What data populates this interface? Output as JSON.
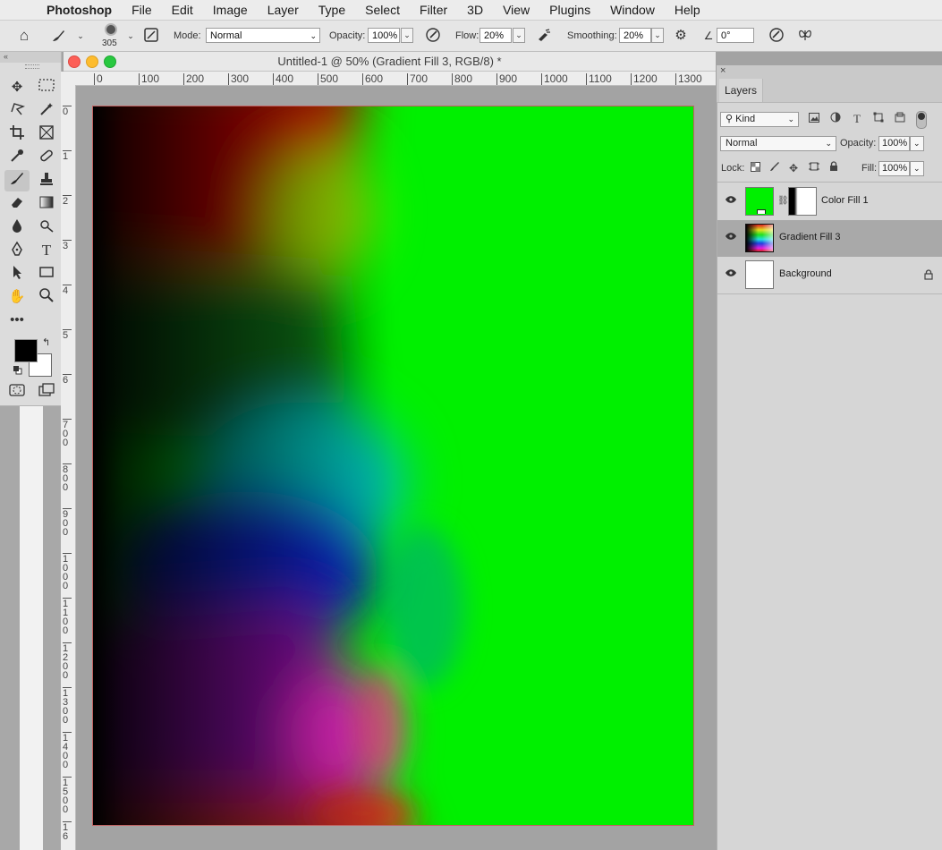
{
  "menubar": {
    "apple_glyph": "",
    "app_name": "Photoshop",
    "items": [
      "File",
      "Edit",
      "Image",
      "Layer",
      "Type",
      "Select",
      "Filter",
      "3D",
      "View",
      "Plugins",
      "Window",
      "Help"
    ]
  },
  "options": {
    "brush_size": "305",
    "mode_label": "Mode:",
    "mode_value": "Normal",
    "opacity_label": "Opacity:",
    "opacity_value": "100%",
    "flow_label": "Flow:",
    "flow_value": "20%",
    "smoothing_label": "Smoothing:",
    "smoothing_value": "20%",
    "angle_value": "0°"
  },
  "document": {
    "title": "Untitled-1 @ 50% (Gradient Fill 3, RGB/8) *",
    "ruler_h": [
      "0",
      "100",
      "200",
      "300",
      "400",
      "500",
      "600",
      "700",
      "800",
      "900",
      "1000",
      "1100",
      "1200",
      "1300"
    ],
    "ruler_v": [
      "0",
      "1",
      "2",
      "3",
      "4",
      "5",
      "6",
      "700",
      "800",
      "900",
      "1000",
      "1100",
      "1200",
      "1300",
      "1400",
      "1500",
      "16"
    ]
  },
  "layers_panel": {
    "tab_label": "Layers",
    "filter_kind": "Kind",
    "blend_mode": "Normal",
    "opacity_label": "Opacity:",
    "opacity_value": "100%",
    "lock_label": "Lock:",
    "fill_label": "Fill:",
    "fill_value": "100%",
    "layers": [
      {
        "name": "Color Fill 1",
        "selected": false,
        "thumb_color": "#00f000"
      },
      {
        "name": "Gradient Fill 3",
        "selected": true
      },
      {
        "name": "Background",
        "selected": false,
        "locked": true
      }
    ]
  },
  "colors": {
    "foreground": "#000000",
    "background": "#ffffff",
    "canvas_green": "#00f000"
  }
}
